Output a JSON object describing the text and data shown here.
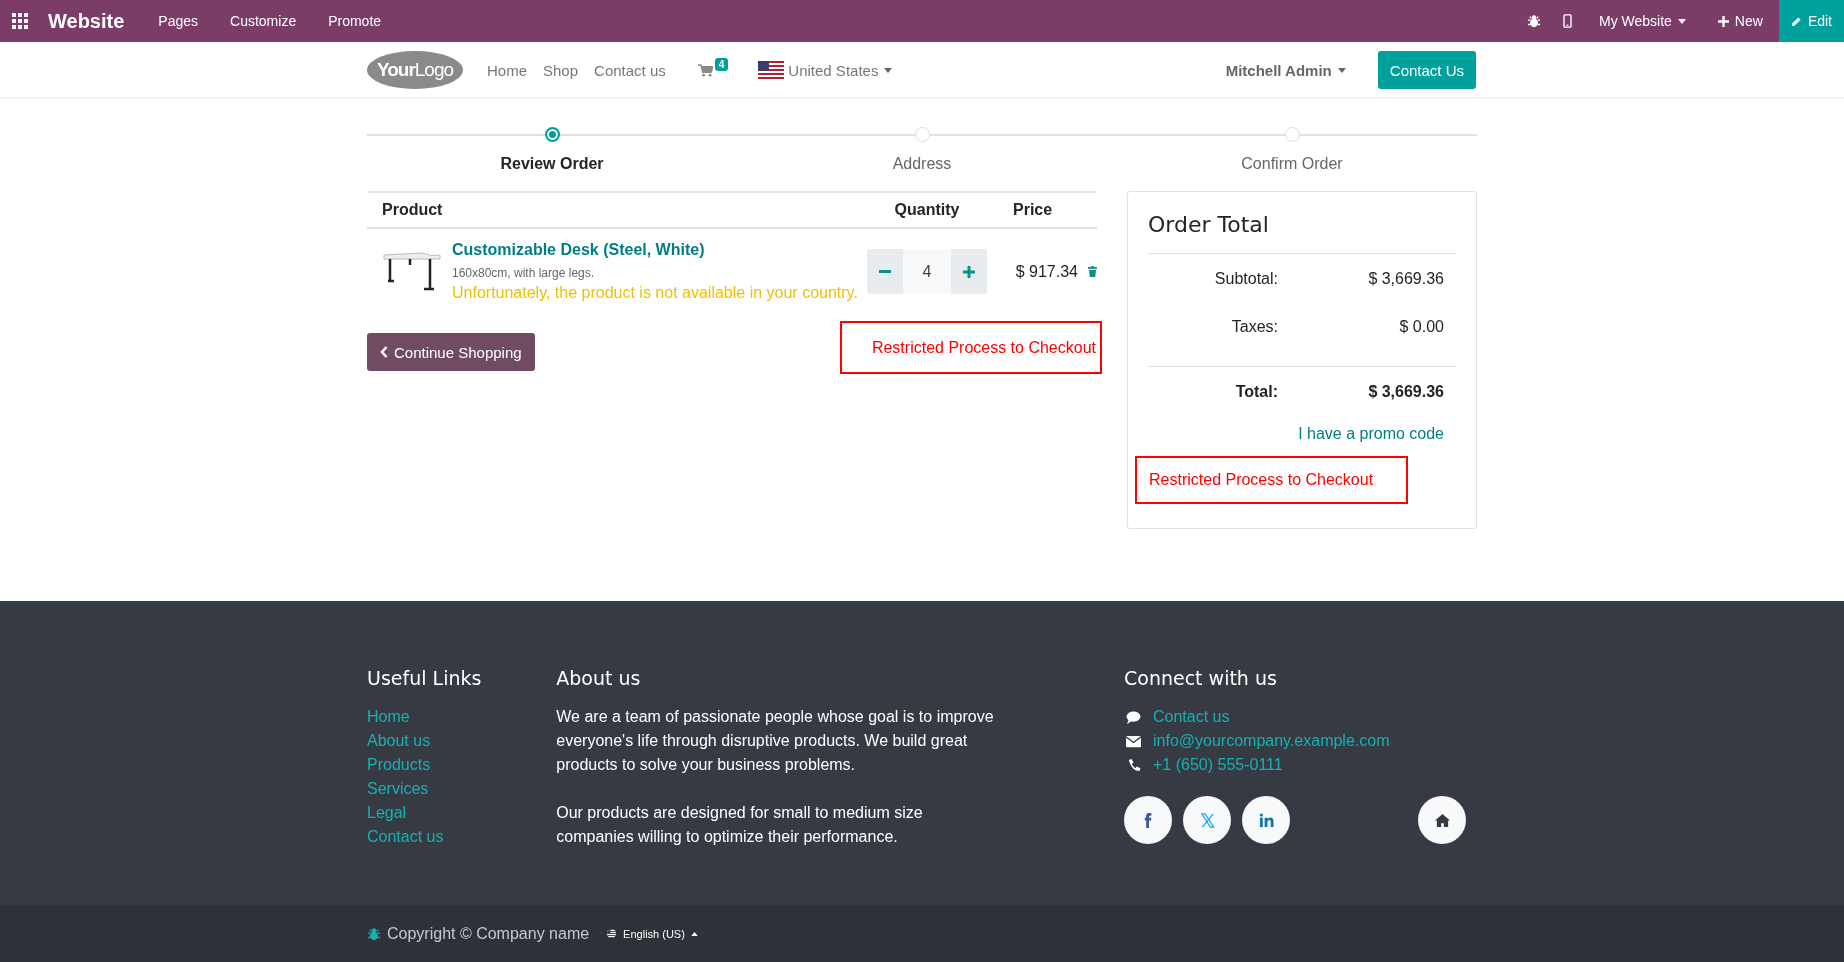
{
  "admin_bar": {
    "app": "Website",
    "menus": [
      "Pages",
      "Customize",
      "Promote"
    ],
    "site_switcher": "My Website",
    "new": "New",
    "edit": "Edit"
  },
  "navbar": {
    "logo": "**Your**Logo",
    "links": [
      "Home",
      "Shop",
      "Contact us"
    ],
    "cart_count": "4",
    "country": "United States",
    "user": "Mitchell Admin",
    "cta": "Contact Us"
  },
  "steps": [
    {
      "label": "Review Order",
      "selected": true
    },
    {
      "label": "Address",
      "selected": false
    },
    {
      "label": "Confirm Order",
      "selected": false
    }
  ],
  "cart": {
    "columns": [
      "Product",
      "Quantity",
      "Price"
    ],
    "rows": [
      {
        "name": "Customizable Desk (Steel, White)",
        "description": "160x80cm, with large legs.",
        "warning": "Unfortunately, the product is not available in your country.",
        "quantity": "4",
        "price": "$ 917.34"
      }
    ],
    "continue": "Continue Shopping",
    "restricted": "Restricted Process to Checkout"
  },
  "order_total": {
    "title": "Order Total",
    "lines": [
      {
        "label": "Subtotal:",
        "value": "$ 3,669.36",
        "kind": "normal"
      },
      {
        "label": "Taxes:",
        "value": "$ 0.00",
        "kind": "normal"
      },
      {
        "label": "Total:",
        "value": "$ 3,669.36",
        "kind": "total"
      }
    ],
    "promo": "I have a promo code",
    "restricted": "Restricted Process to Checkout"
  },
  "footer": {
    "useful_links": {
      "title": "Useful Links",
      "links": [
        "Home",
        "About us",
        "Products",
        "Services",
        "Legal",
        "Contact us"
      ]
    },
    "about": {
      "title": "About us",
      "paragraphs": [
        "We are a team of passionate people whose goal is to improve everyone's life through disruptive products. We build great products to solve your business problems.",
        "Our products are designed for small to medium size companies willing to optimize their performance."
      ]
    },
    "connect": {
      "title": "Connect with us",
      "contacts": [
        {
          "kind": "chat",
          "text": "Contact us"
        },
        {
          "kind": "mail",
          "text": "info@yourcompany.example.com"
        },
        {
          "kind": "phone",
          "text": "+1 (650) 555-0111"
        }
      ]
    }
  },
  "copyright": {
    "text": "Copyright © Company name",
    "language": "English (US)"
  }
}
